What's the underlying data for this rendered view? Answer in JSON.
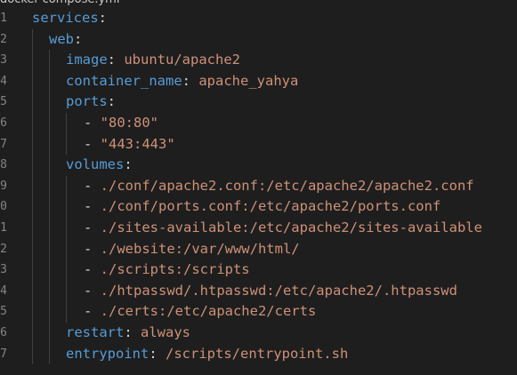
{
  "editor": {
    "tab_title": "docker-compose.yml",
    "colors": {
      "background": "#1e1e1e",
      "key": "#569cd6",
      "value": "#ce9178",
      "punctuation": "#d4d4d4",
      "line_number": "#858585",
      "indent_guide": "#404040"
    }
  },
  "gutter": {
    "line_numbers": [
      "1",
      "1",
      "2",
      "3",
      "4",
      "5",
      "6",
      "7",
      "8",
      "9",
      "0",
      "1",
      "2",
      "3",
      "4",
      "5",
      "6",
      "7"
    ]
  },
  "code": {
    "lines": [
      {
        "key": "services",
        "colon": ":",
        "value": ""
      },
      {
        "key": "web",
        "colon": ":",
        "value": ""
      },
      {
        "key": "image",
        "colon": ":",
        "value": " ubuntu/apache2"
      },
      {
        "key": "container_name",
        "colon": ":",
        "value": " apache_yahya"
      },
      {
        "key": "ports",
        "colon": ":",
        "value": ""
      },
      {
        "key": "",
        "colon": "- ",
        "value": "\"80:80\""
      },
      {
        "key": "",
        "colon": "- ",
        "value": "\"443:443\""
      },
      {
        "key": "volumes",
        "colon": ":",
        "value": ""
      },
      {
        "key": "",
        "colon": "- ",
        "value": "./conf/apache2.conf:/etc/apache2/apache2.conf"
      },
      {
        "key": "",
        "colon": "- ",
        "value": "./conf/ports.conf:/etc/apache2/ports.conf"
      },
      {
        "key": "",
        "colon": "- ",
        "value": "./sites-available:/etc/apache2/sites-available"
      },
      {
        "key": "",
        "colon": "- ",
        "value": "./website:/var/www/html/"
      },
      {
        "key": "",
        "colon": "- ",
        "value": "./scripts:/scripts"
      },
      {
        "key": "",
        "colon": "- ",
        "value": "./htpasswd/.htpasswd:/etc/apache2/.htpasswd"
      },
      {
        "key": "",
        "colon": "- ",
        "value": "./certs:/etc/apache2/certs"
      },
      {
        "key": "restart",
        "colon": ":",
        "value": " always"
      },
      {
        "key": "entrypoint",
        "colon": ":",
        "value": " /scripts/entrypoint.sh"
      }
    ]
  }
}
